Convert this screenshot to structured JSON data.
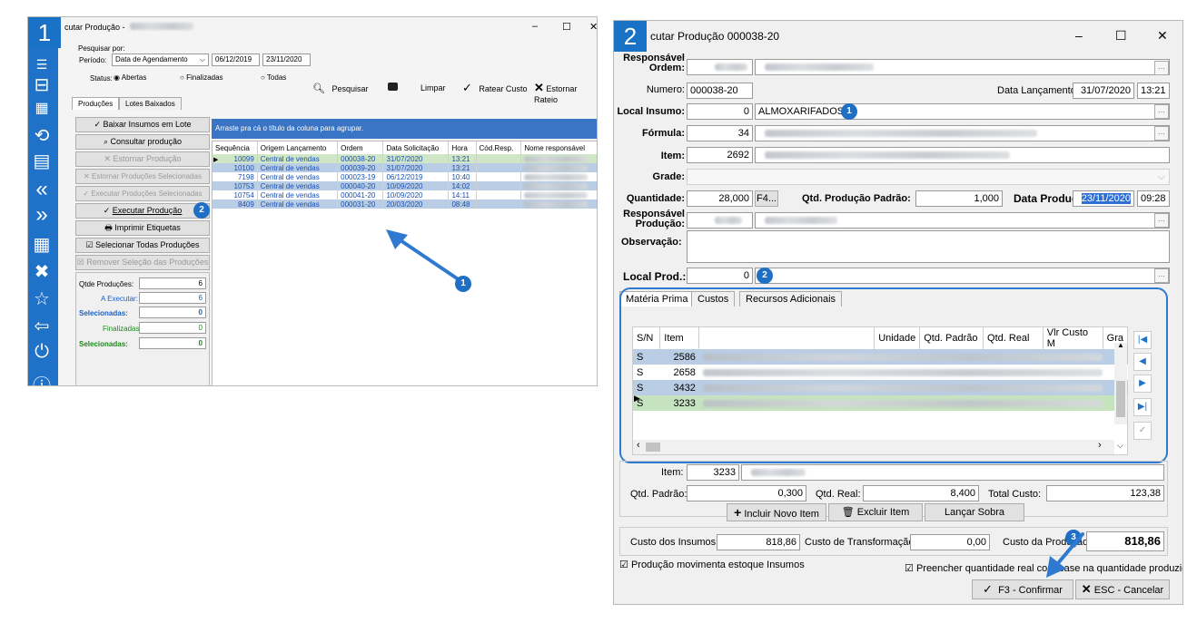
{
  "left": {
    "step": "1",
    "title": "cutar Produção -",
    "window_controls": {
      "min": "–",
      "max": "☐",
      "close": "✕"
    },
    "filter": {
      "pesquisar_por": "Pesquisar por:",
      "periodo_label": "Período:",
      "periodo_value": "Data de Agendamento",
      "date_from": "06/12/2019",
      "date_to": "23/11/2020",
      "status_label": "Status:",
      "status_options": [
        "Abertas",
        "Finalizadas",
        "Todas"
      ]
    },
    "toolbar": {
      "pesquisar": "Pesquisar",
      "limpar": "Limpar",
      "ratear": "Ratear Custo",
      "estornar_rateio": "Estornar Rateio"
    },
    "tabs": [
      "Produções",
      "Lotes Baixados"
    ],
    "actions": [
      "Baixar Insumos em Lote",
      "Consultar produção",
      "Estornar Produção",
      "Estornar Produções Selecionadas",
      "Executar Produções Selecionadas",
      "Executar Produção",
      "Imprimir Etiquetas",
      "Selecionar Todas Produções",
      "Remover Seleção das Produções"
    ],
    "counters": [
      {
        "label": "Qtde Produções:",
        "value": "6"
      },
      {
        "label": "A Executar:",
        "value": "6"
      },
      {
        "label": "Selecionadas:",
        "value": "0"
      },
      {
        "label": "Finalizadas:",
        "value": "0"
      },
      {
        "label": "Selecionadas:",
        "value": "0"
      }
    ],
    "group_hint": "Arraste pra cá o título da coluna para agrupar.",
    "grid_headers": [
      "Sequência",
      "Origem Lançamento",
      "Ordem",
      "Data Solicitação",
      "Hora",
      "Cód.Resp.",
      "Nome responsável"
    ],
    "grid_rows": [
      [
        "10099",
        "Central de vendas",
        "000038-20",
        "31/07/2020",
        "13:21"
      ],
      [
        "10100",
        "Central de vendas",
        "000039-20",
        "31/07/2020",
        "13:21"
      ],
      [
        "7198",
        "Central de vendas",
        "000023-19",
        "06/12/2019",
        "10:40"
      ],
      [
        "10753",
        "Central de vendas",
        "000040-20",
        "10/09/2020",
        "14:02"
      ],
      [
        "10754",
        "Central de vendas",
        "000041-20",
        "10/09/2020",
        "14:11"
      ],
      [
        "8409",
        "Central de vendas",
        "000031-20",
        "20/03/2020",
        "08:48"
      ]
    ],
    "badges": {
      "executar": "2",
      "grid": "1"
    }
  },
  "right": {
    "step": "2",
    "title": "cutar Produção 000038-20",
    "window_controls": {
      "min": "–",
      "max": "☐",
      "close": "✕"
    },
    "responsavel_ordem": "Responsável Ordem:",
    "numero_label": "Numero:",
    "numero_value": "000038-20",
    "data_lanc_label": "Data Lançamento:",
    "data_lanc_value": "31/07/2020",
    "hora_lanc_value": "13:21",
    "local_insumo_label": "Local Insumo:",
    "local_insumo_code": "0",
    "local_insumo_name": "ALMOXARIFADOS",
    "formula_label": "Fórmula:",
    "formula_value": "34",
    "item_label": "Item:",
    "item_value": "2692",
    "grade_label": "Grade:",
    "quantidade_label": "Quantidade:",
    "quantidade_value": "28,000",
    "f4_label": "F4...",
    "qtd_padrao_label": "Qtd. Produção Padrão:",
    "qtd_padrao_value": "1,000",
    "data_producao_label": "Data Produção:",
    "data_producao_value": "23/11/2020",
    "hora_producao_value": "09:28",
    "responsavel_producao": "Responsável Produção:",
    "observacao_label": "Observação:",
    "local_prod_label": "Local Prod.:",
    "local_prod_value": "0",
    "tabs": [
      "Matéria Prima",
      "Custos",
      "Recursos Adicionais"
    ],
    "grid_headers": [
      "S/N",
      "Item",
      "",
      "Unidade",
      "Qtd. Padrão",
      "Qtd. Real",
      "Vlr Custo M",
      "Gra"
    ],
    "grid_rows": [
      [
        "S",
        "2586"
      ],
      [
        "S",
        "2658"
      ],
      [
        "S",
        "3432"
      ],
      [
        "S",
        "3233"
      ]
    ],
    "item_detail_label": "Item:",
    "item_detail_value": "3233",
    "qtd_padrao_detail_label": "Qtd. Padrão:",
    "qtd_padrao_detail_value": "0,300",
    "qtd_real_label": "Qtd. Real:",
    "qtd_real_value": "8,400",
    "total_custo_label": "Total Custo:",
    "total_custo_value": "123,38",
    "buttons": {
      "incluir": "Incluir Novo Item",
      "excluir": "Excluir Item",
      "sobra": "Lançar Sobra"
    },
    "custo_insumos_label": "Custo dos Insumos:",
    "custo_insumos_value": "818,86",
    "custo_transf_label": "Custo de Transformação:",
    "custo_transf_value": "0,00",
    "custo_producao_label": "Custo da Produção:",
    "custo_producao_value": "818,86",
    "check_movimenta": "Produção movimenta estoque Insumos",
    "check_preencher": "Preencher quantidade real com base na quantidade produzida",
    "confirmar": "F3 - Confirmar",
    "cancelar": "ESC - Cancelar",
    "badges": {
      "local_insumo": "1",
      "local_prod": "2",
      "confirmar": "3"
    }
  }
}
